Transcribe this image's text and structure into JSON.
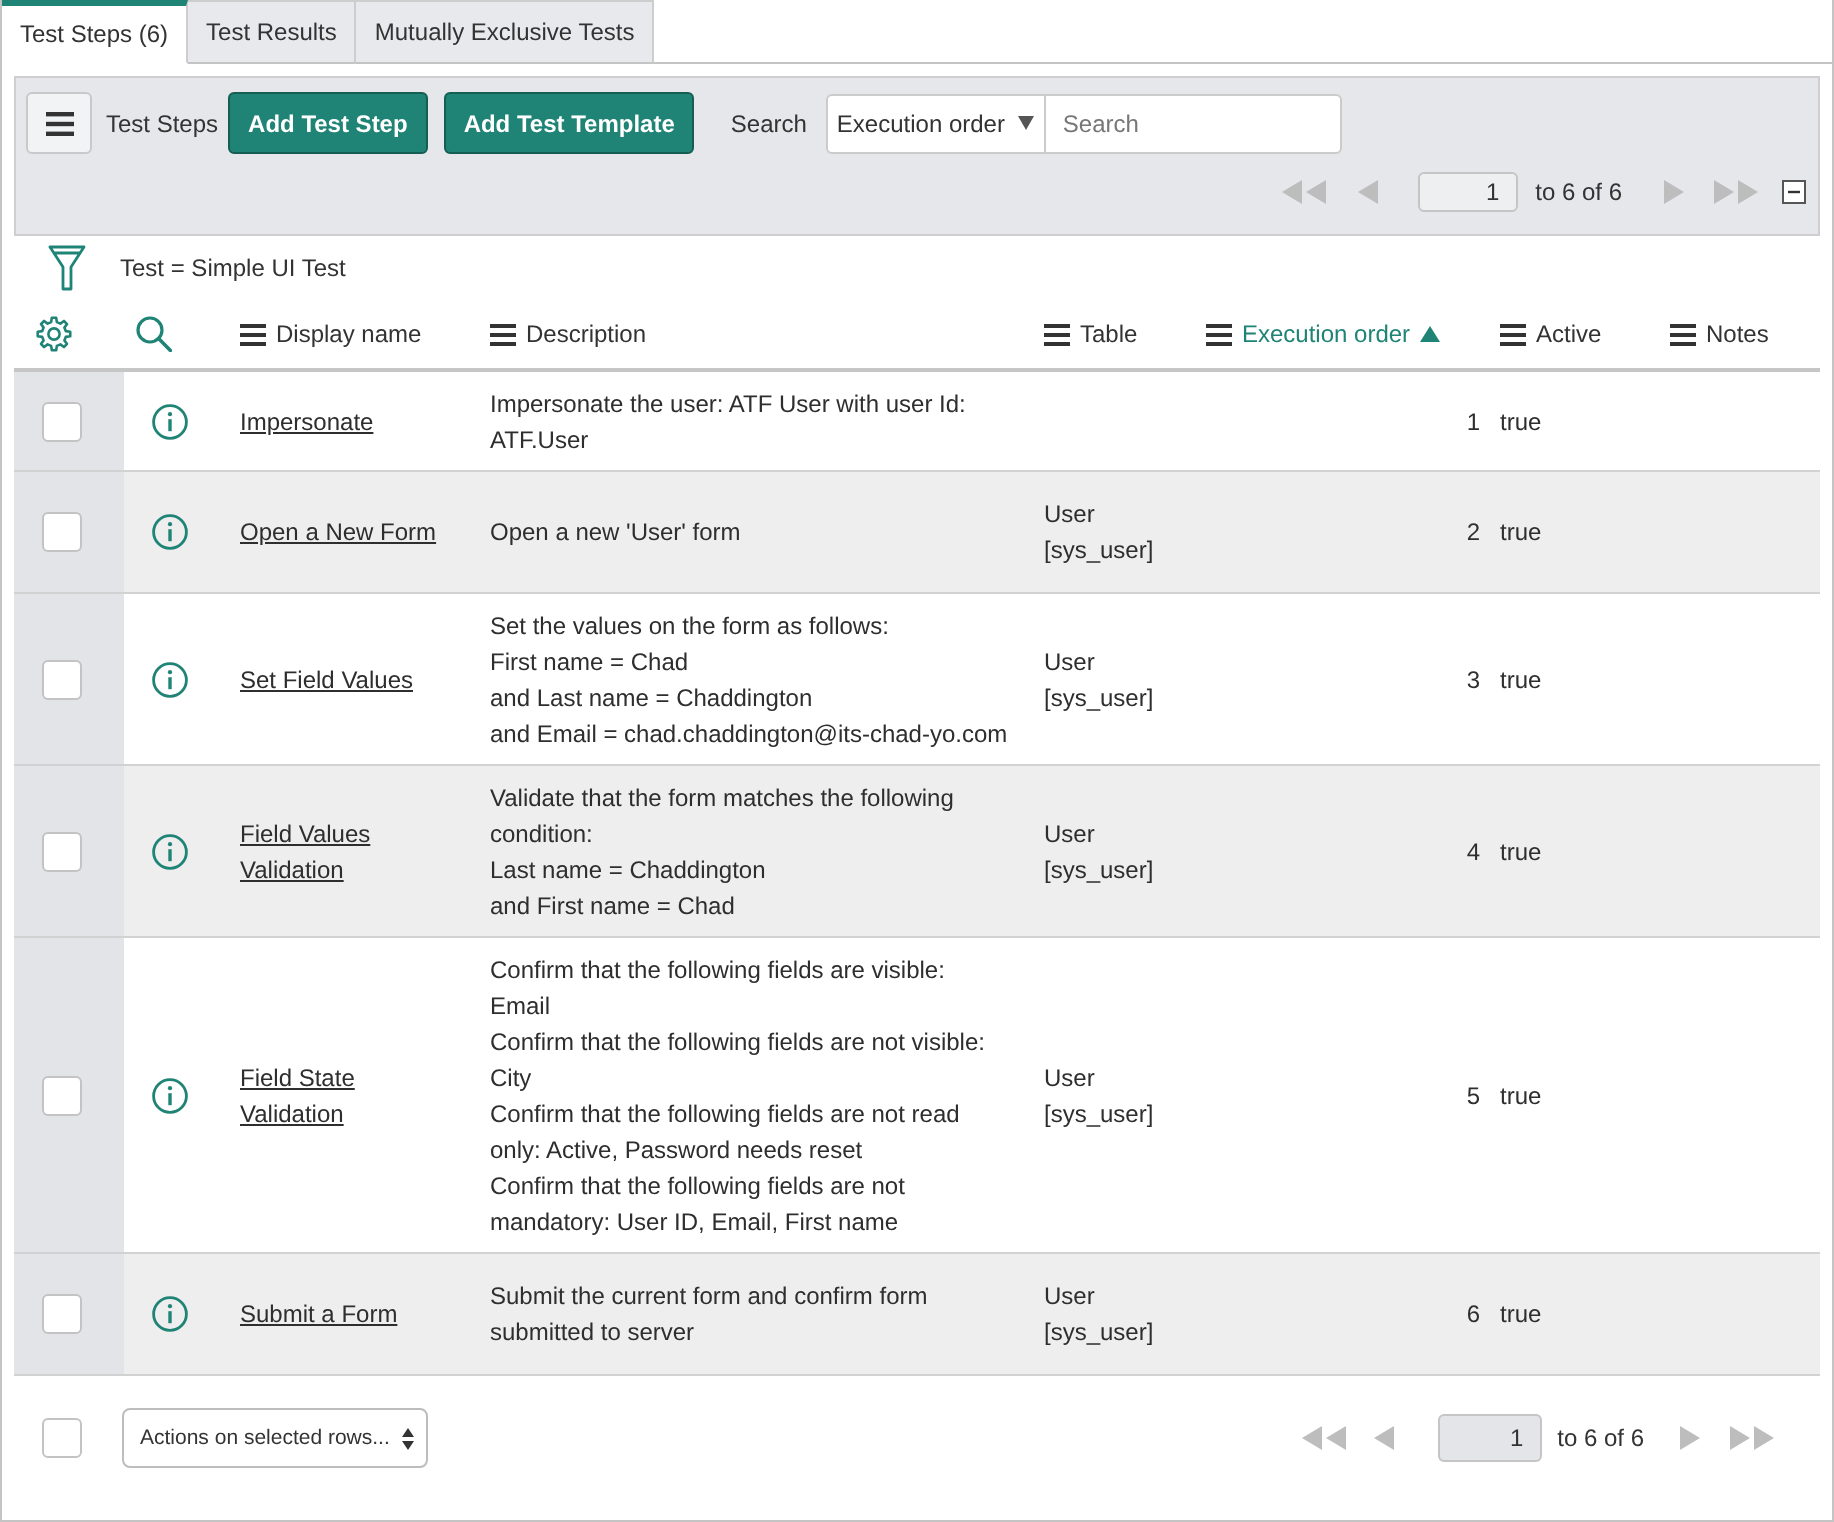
{
  "tabs": [
    {
      "label": "Test Steps (6)",
      "selected": true
    },
    {
      "label": "Test Results",
      "selected": false
    },
    {
      "label": "Mutually Exclusive Tests",
      "selected": false
    }
  ],
  "toolbar": {
    "title": "Test Steps",
    "buttons": [
      "Add Test Step",
      "Add Test Template"
    ],
    "search_label": "Search",
    "search_field": "Execution order",
    "search_box": {
      "placeholder": "Search"
    },
    "pager": {
      "page": "1",
      "range": "to 6 of 6"
    }
  },
  "filter": "Test = Simple UI Test",
  "table": {
    "columns": [
      {
        "label": "Display name",
        "sorted": false
      },
      {
        "label": "Description",
        "sorted": false
      },
      {
        "label": "Table",
        "sorted": false
      },
      {
        "label": "Execution order",
        "sorted": true
      },
      {
        "label": "Active",
        "sorted": false
      },
      {
        "label": "Notes",
        "sorted": false
      }
    ],
    "rows": [
      {
        "checked": false,
        "display_name": "Impersonate",
        "description": "Impersonate the user: ATF User with user Id:\nATF.User",
        "order": "1",
        "active": "true"
      },
      {
        "checked": false,
        "display_name": "Open a New Form",
        "description": "Open a new 'User' form",
        "table": "User\n[sys_user]",
        "order": "2",
        "active": "true"
      },
      {
        "checked": false,
        "display_name": "Set Field Values",
        "description": "Set the values on the form as follows:\nFirst name = Chad\nand Last name = Chaddington\nand Email = chad.chaddington@its-chad-yo.com",
        "table": "User\n[sys_user]",
        "order": "3",
        "active": "true"
      },
      {
        "checked": false,
        "display_name": "Field Values\nValidation",
        "description": "Validate that the form matches the following\ncondition:\nLast name = Chaddington\nand First name = Chad",
        "table": "User\n[sys_user]",
        "order": "4",
        "active": "true"
      },
      {
        "checked": false,
        "display_name": "Field State\nValidation",
        "description": "Confirm that the following fields are visible:\nEmail\nConfirm that the following fields are not visible:\nCity\nConfirm that the following fields are not read\nonly: Active, Password needs reset\nConfirm that the following fields are not\nmandatory: User ID, Email, First name",
        "table": "User\n[sys_user]",
        "order": "5",
        "active": "true"
      },
      {
        "checked": false,
        "display_name": "Submit a Form",
        "description": "Submit the current form and confirm form\nsubmitted to server",
        "table": "User\n[sys_user]",
        "order": "6",
        "active": "true"
      }
    ]
  },
  "footer": {
    "checked": false,
    "actions": "Actions on selected rows...",
    "pager": {
      "page": "1",
      "range": "to 6 of 6"
    }
  }
}
